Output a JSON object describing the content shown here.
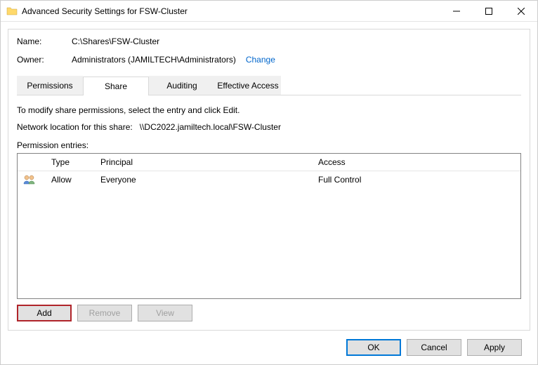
{
  "titlebar": {
    "title": "Advanced Security Settings for FSW-Cluster"
  },
  "meta": {
    "name_label": "Name:",
    "name_value": "C:\\Shares\\FSW-Cluster",
    "owner_label": "Owner:",
    "owner_value": "Administrators (JAMILTECH\\Administrators)",
    "change_link": "Change"
  },
  "tabs": {
    "permissions": "Permissions",
    "share": "Share",
    "auditing": "Auditing",
    "effective": "Effective Access"
  },
  "body": {
    "instruction": "To modify share permissions, select the entry and click Edit.",
    "netloc_label": "Network location for this share:",
    "netloc_value": "\\\\DC2022.jamiltech.local\\FSW-Cluster",
    "entries_label": "Permission entries:"
  },
  "grid": {
    "headers": {
      "type": "Type",
      "principal": "Principal",
      "access": "Access"
    },
    "rows": [
      {
        "type": "Allow",
        "principal": "Everyone",
        "access": "Full Control"
      }
    ]
  },
  "buttons": {
    "add": "Add",
    "remove": "Remove",
    "view": "View",
    "ok": "OK",
    "cancel": "Cancel",
    "apply": "Apply"
  }
}
